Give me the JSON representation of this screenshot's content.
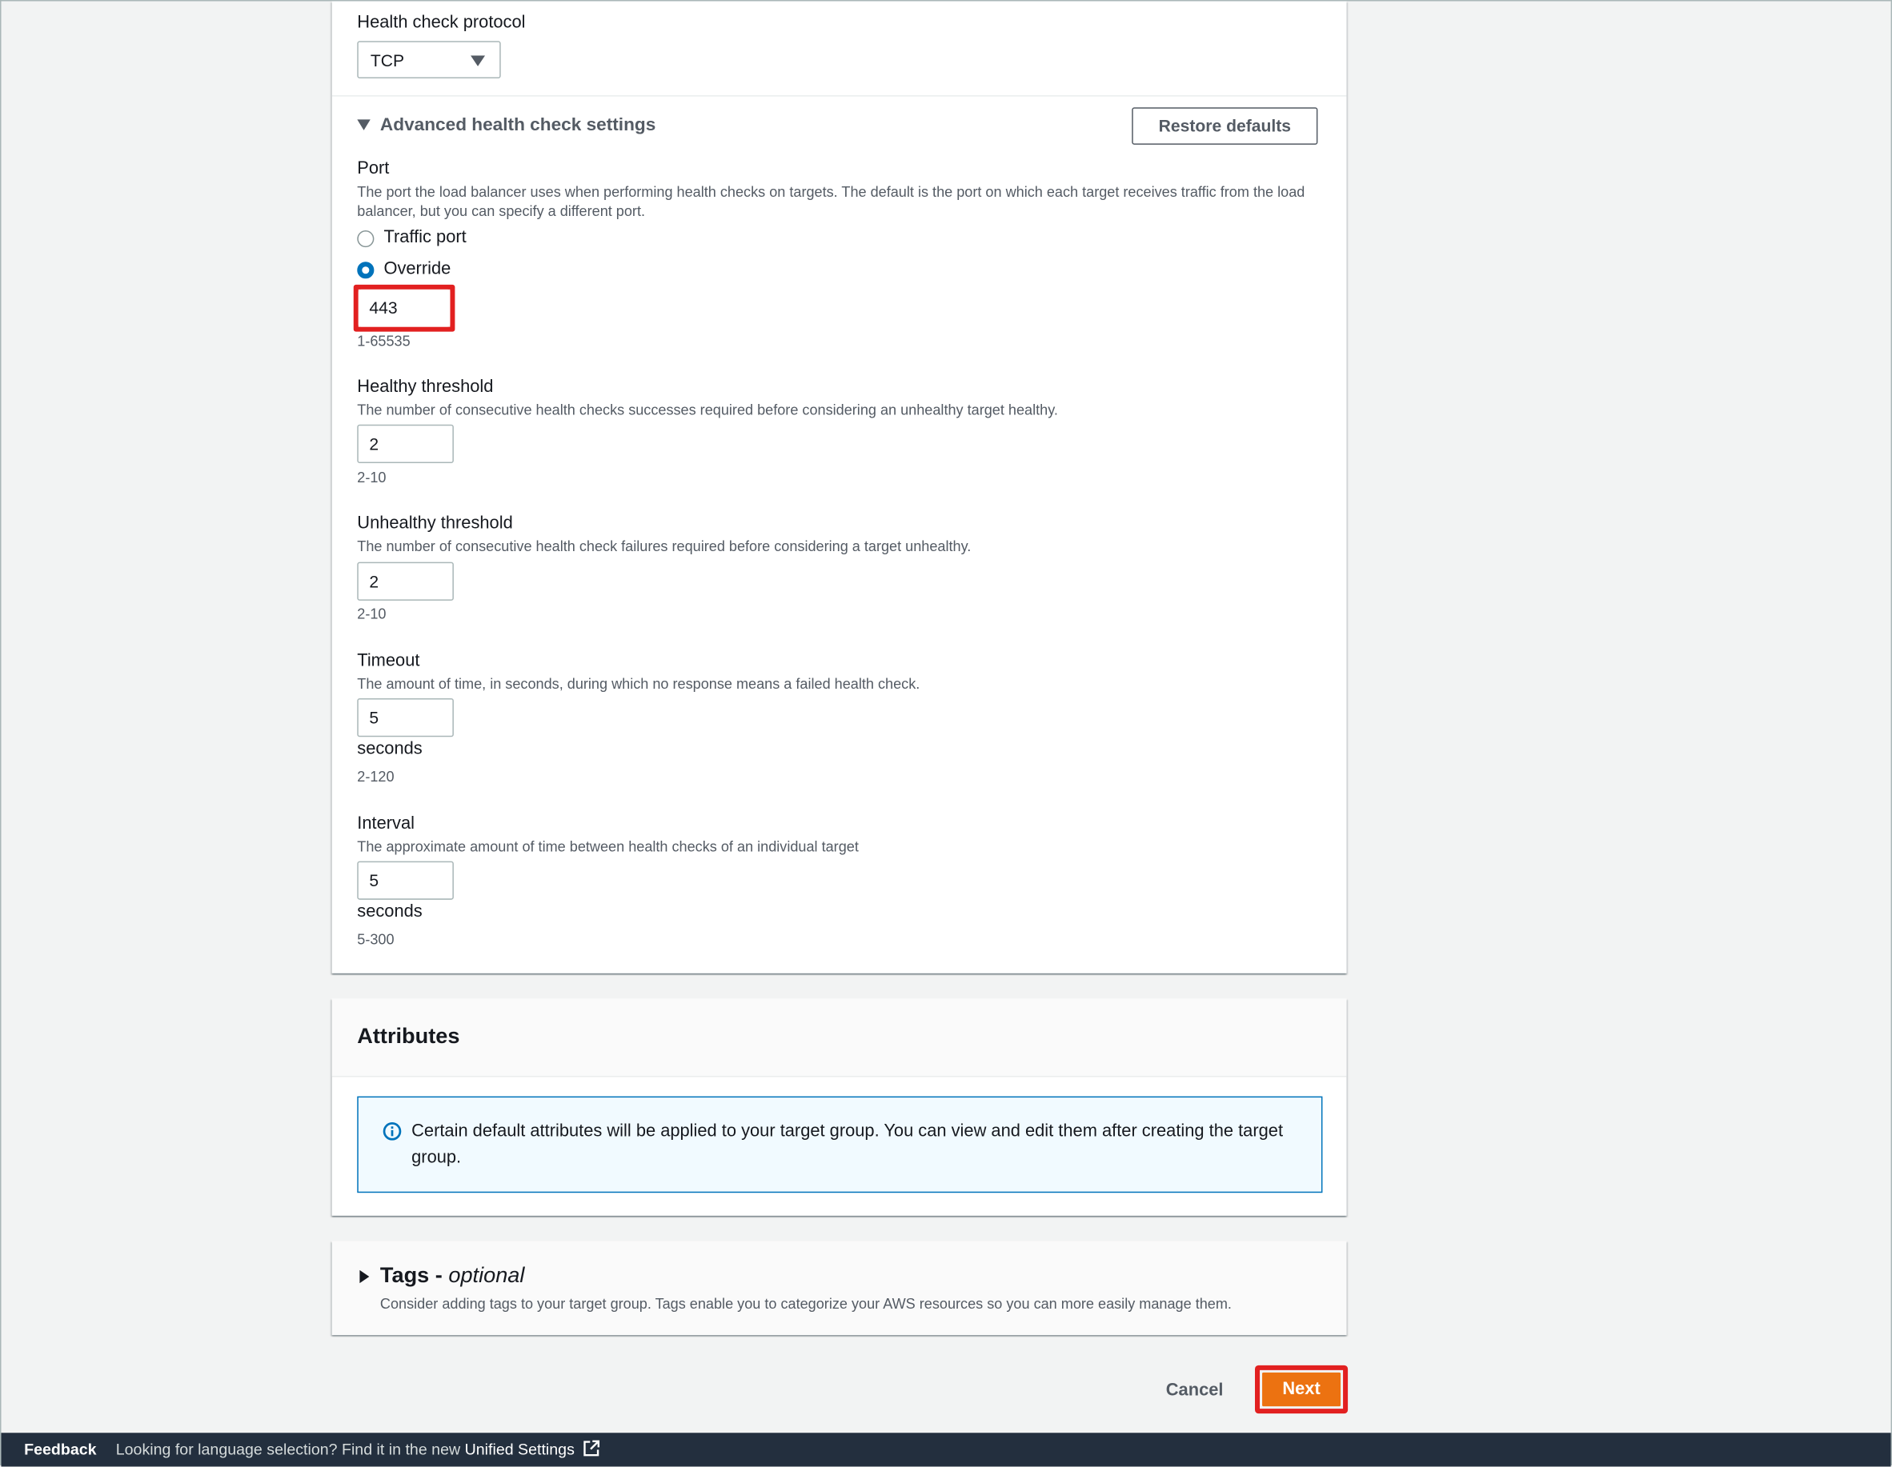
{
  "health_check": {
    "protocol_label": "Health check protocol",
    "protocol_value": "TCP"
  },
  "advanced": {
    "title": "Advanced health check settings",
    "restore_label": "Restore defaults",
    "port": {
      "label": "Port",
      "description": "The port the load balancer uses when performing health checks on targets. The default is the port on which each target receives traffic from the load balancer, but you can specify a different port.",
      "option_traffic": "Traffic port",
      "option_override": "Override",
      "selected": "Override",
      "value": "443",
      "hint": "1-65535"
    },
    "healthy": {
      "label": "Healthy threshold",
      "description": "The number of consecutive health checks successes required before considering an unhealthy target healthy.",
      "value": "2",
      "hint": "2-10"
    },
    "unhealthy": {
      "label": "Unhealthy threshold",
      "description": "The number of consecutive health check failures required before considering a target unhealthy.",
      "value": "2",
      "hint": "2-10"
    },
    "timeout": {
      "label": "Timeout",
      "description": "The amount of time, in seconds, during which no response means a failed health check.",
      "value": "5",
      "unit": "seconds",
      "hint": "2-120"
    },
    "interval": {
      "label": "Interval",
      "description": "The approximate amount of time between health checks of an individual target",
      "value": "5",
      "unit": "seconds",
      "hint": "5-300"
    }
  },
  "attributes": {
    "title": "Attributes",
    "info_text": "Certain default attributes will be applied to your target group. You can view and edit them after creating the target group."
  },
  "tags": {
    "title": "Tags - ",
    "title_suffix": "optional",
    "description": "Consider adding tags to your target group. Tags enable you to categorize your AWS resources so you can more easily manage them."
  },
  "actions": {
    "cancel_label": "Cancel",
    "next_label": "Next"
  },
  "footer": {
    "feedback_label": "Feedback",
    "language_text": "Looking for language selection? Find it in the new ",
    "unified_settings_label": "Unified Settings"
  },
  "colors": {
    "primary_button": "#ec7211",
    "highlight": "#e22020",
    "info_border": "#0073bb",
    "footer_bg": "#232f3e"
  }
}
